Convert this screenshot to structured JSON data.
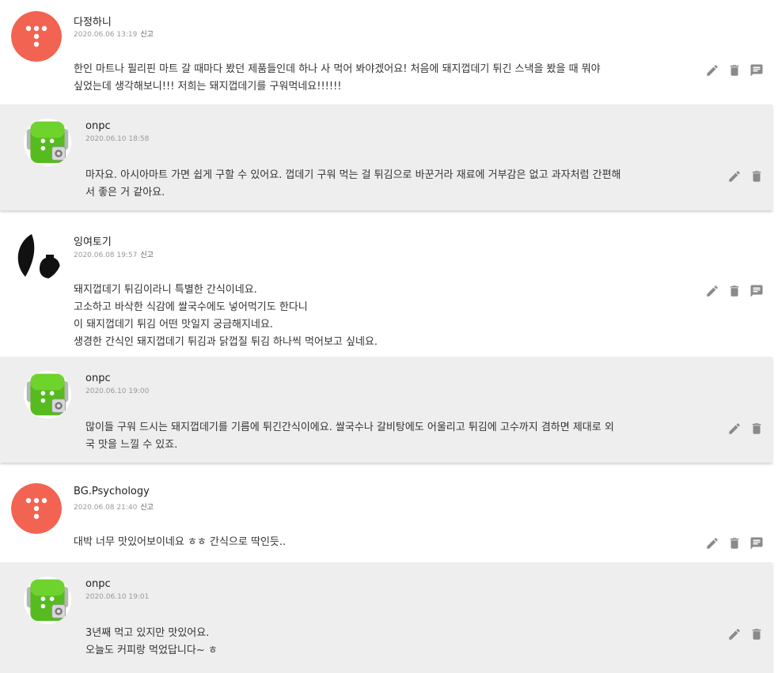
{
  "colors": {
    "pin_avatar": "#f26352",
    "reply_bg": "#eeeeee",
    "icon": "#8a8a8a",
    "green_avatar": "#55bb1e"
  },
  "icons": {
    "edit": "pencil-icon",
    "delete": "trash-icon",
    "reply": "comment-icon"
  },
  "report_label": "신고",
  "comments": [
    {
      "author": "다정하니",
      "date": "2020.06.06 13:19",
      "text": "한인 마트나 필리핀 마트 갈 때마다 봤던 제품들인데 하나 사 먹어 봐야겠어요! 처음에 돼지껍데기 튀긴 스낵을 봤을 때 뭐야\n싶었는데 생각해보니!!! 저희는 돼지껍데기를 구워먹네요!!!!!!",
      "reply": {
        "author": "onpc",
        "date": "2020.06.10 18:58",
        "text": "마자요. 아시아마트 가면 쉽게 구할 수 있어요. 껍데기 구워 먹는 걸 튀김으로 바꾼거라 재료에 거부감은 없고 과자처럼 간편해\n서 좋은 거 같아요."
      }
    },
    {
      "author": "잉여토기",
      "date": "2020.06.08 19:57",
      "text": "돼지껍데기 튀김이라니 특별한 간식이네요.\n고소하고 바삭한 식감에 쌀국수에도 넣어먹기도 한다니\n이 돼지껍데기 튀김 어떤 맛일지 궁금해지네요.\n생경한 간식인 돼지껍데기 튀김과 닭껍질 튀김 하나씩 먹어보고 싶네요.",
      "reply": {
        "author": "onpc",
        "date": "2020.06.10 19:00",
        "text": "많이들 구워 드시는 돼지껍데기를 기름에 튀긴간식이에요. 쌀국수나 갈비탕에도 어울리고 튀김에 고수까지 겸하면 제대로 외\n국 맛을 느낄 수 있죠."
      }
    },
    {
      "author": "BG.Psychology",
      "date": "2020.06.08 21:40",
      "text": "대박 너무 맛있어보이네요 ㅎㅎ 간식으로 딱인듯..",
      "reply": {
        "author": "onpc",
        "date": "2020.06.10 19:01",
        "text": "3년째 먹고 있지만 맛있어요.\n오늘도 커피랑 먹었답니다~ ㅎ"
      }
    }
  ]
}
